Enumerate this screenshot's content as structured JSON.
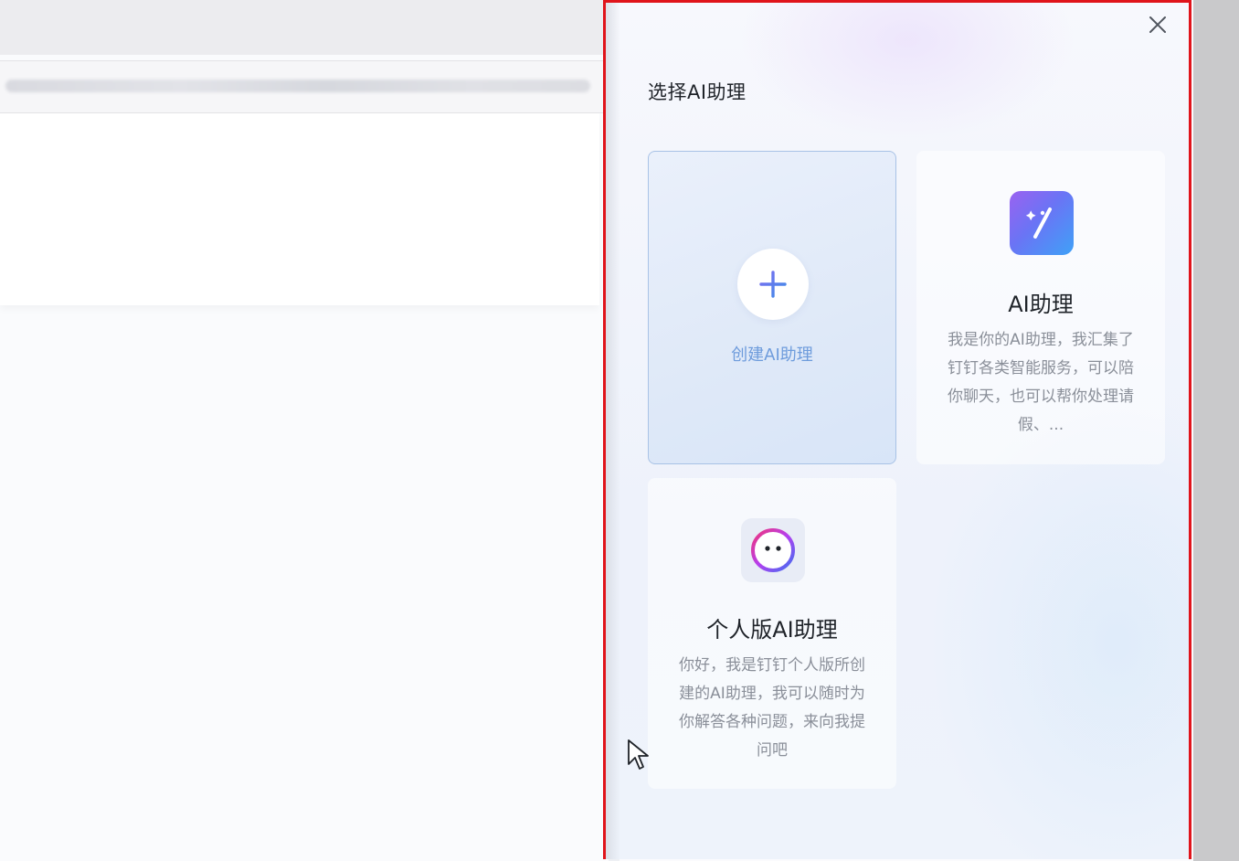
{
  "drawer": {
    "title": "选择AI助理",
    "close_icon": "close-icon"
  },
  "cards": {
    "create": {
      "label": "创建AI助理",
      "icon": "plus-icon"
    },
    "ai_assistant": {
      "name": "AI助理",
      "description": "我是你的AI助理，我汇集了钉钉各类智能服务，可以陪你聊天，也可以帮你处理请假、...",
      "icon": "magic-wand-icon"
    },
    "personal": {
      "name": "个人版AI助理",
      "description": "你好，我是钉钉个人版所创建的AI助理，我可以随时为你解答各种问题，来向我提问吧",
      "icon": "smiley-face-icon"
    }
  },
  "colors": {
    "highlight_border": "#e0141b",
    "accent_blue": "#3f7de6",
    "title_text": "#1f2329",
    "desc_text": "#8a8f99"
  }
}
